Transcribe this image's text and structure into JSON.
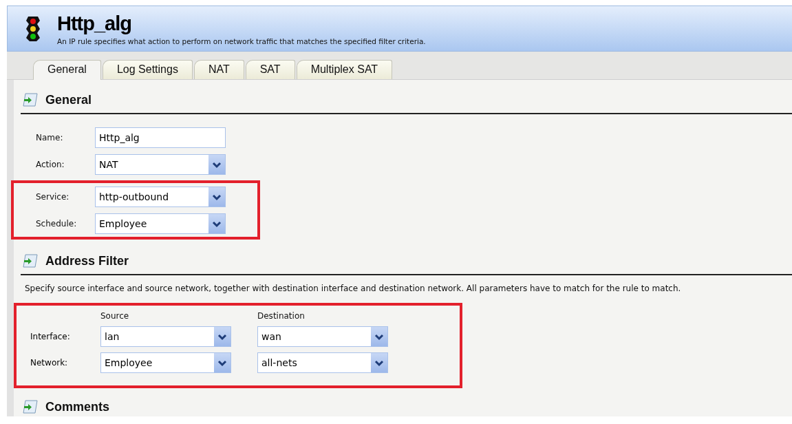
{
  "header": {
    "title": "Http_alg",
    "description": "An IP rule specifies what action to perform on network traffic that matches the specified filter criteria."
  },
  "tabs": [
    {
      "label": "General",
      "selected": true
    },
    {
      "label": "Log Settings",
      "selected": false
    },
    {
      "label": "NAT",
      "selected": false
    },
    {
      "label": "SAT",
      "selected": false
    },
    {
      "label": "Multiplex SAT",
      "selected": false
    }
  ],
  "general": {
    "heading": "General",
    "groups": [
      {
        "highlighted": false,
        "fields": [
          {
            "label": "Name:",
            "kind": "text",
            "value": "Http_alg"
          },
          {
            "label": "Action:",
            "kind": "select",
            "value": "NAT"
          }
        ]
      },
      {
        "highlighted": true,
        "fields": [
          {
            "label": "Service:",
            "kind": "select",
            "value": "http-outbound"
          },
          {
            "label": "Schedule:",
            "kind": "select",
            "value": "Employee"
          }
        ]
      }
    ]
  },
  "address_filter": {
    "heading": "Address Filter",
    "description": "Specify source interface and source network, together with destination interface and destination network. All parameters have to match for the rule to match.",
    "highlighted": true,
    "columns": [
      "Source",
      "Destination"
    ],
    "rows": [
      {
        "label": "Interface:",
        "source": "lan",
        "destination": "wan"
      },
      {
        "label": "Network:",
        "source": "Employee",
        "destination": "all-nets"
      }
    ]
  },
  "comments": {
    "heading": "Comments"
  }
}
